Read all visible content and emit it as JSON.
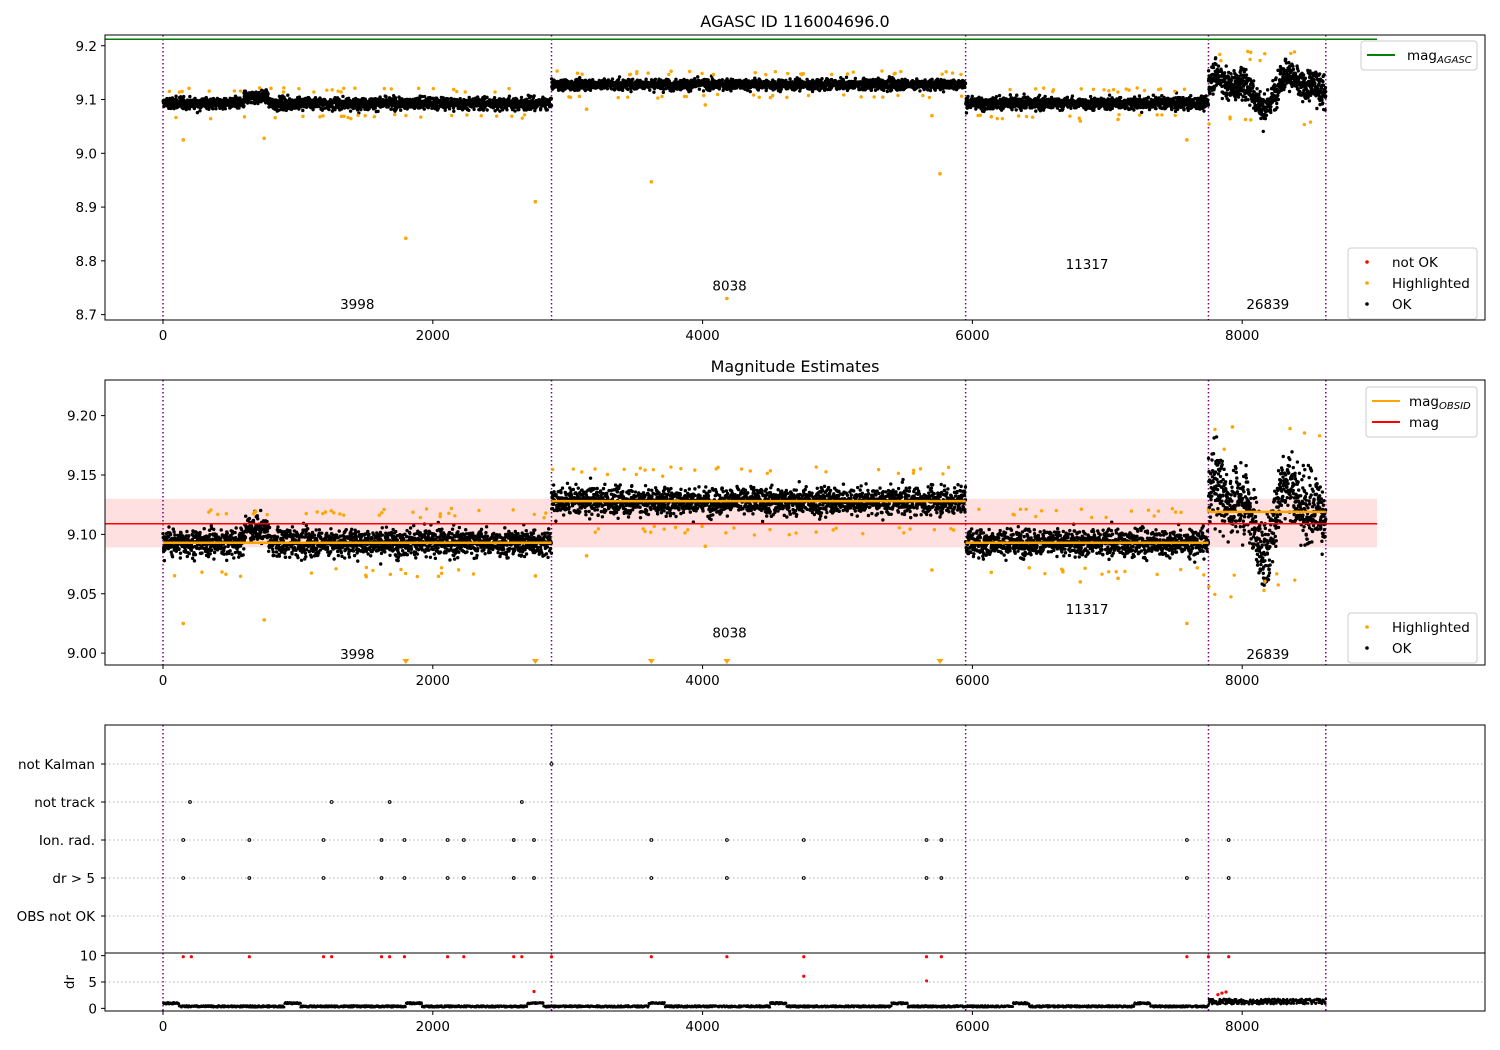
{
  "chart_data": [
    {
      "type": "scatter",
      "title": "AGASC ID 116004696.0",
      "xlim": [
        -430,
        9800
      ],
      "ylim": [
        8.69,
        9.22
      ],
      "x_ticks": [
        0,
        2000,
        4000,
        6000,
        8000
      ],
      "y_ticks": [
        8.7,
        8.8,
        8.9,
        9.0,
        9.1,
        9.2
      ],
      "y_tick_labels": [
        "8.7",
        "8.8",
        "8.9",
        "9.0",
        "9.1",
        "9.2"
      ],
      "obs_boundaries": [
        0,
        2880,
        5950,
        7750,
        8620
      ],
      "obs_labels": [
        {
          "text": "3998",
          "x": 1440,
          "y": 8.71
        },
        {
          "text": "8038",
          "x": 4200,
          "y": 8.745
        },
        {
          "text": "11317",
          "x": 6850,
          "y": 8.785
        },
        {
          "text": "26839",
          "x": 8190,
          "y": 8.71
        }
      ],
      "segments": [
        {
          "x0": 0,
          "x1": 2880,
          "level": 9.093,
          "noise": 0.008
        },
        {
          "x0": 2880,
          "x1": 5950,
          "level": 9.128,
          "noise": 0.007
        },
        {
          "x0": 5950,
          "x1": 7750,
          "level": 9.093,
          "noise": 0.008
        },
        {
          "x0": 7750,
          "x1": 8620,
          "level": 9.12,
          "noise": 0.02
        }
      ],
      "series": [
        {
          "name": "mag_AGASC",
          "type": "line",
          "color": "#008000",
          "y": 9.212,
          "x": [
            -430,
            9000
          ]
        }
      ],
      "highlighted_outliers": [
        {
          "x": 150,
          "y": 9.025
        },
        {
          "x": 750,
          "y": 9.028
        },
        {
          "x": 1800,
          "y": 8.842
        },
        {
          "x": 2760,
          "y": 8.91
        },
        {
          "x": 3620,
          "y": 8.947
        },
        {
          "x": 4180,
          "y": 8.73
        },
        {
          "x": 5760,
          "y": 8.962
        },
        {
          "x": 7590,
          "y": 9.025
        },
        {
          "x": 5700,
          "y": 9.07
        },
        {
          "x": 4020,
          "y": 9.09
        },
        {
          "x": 3140,
          "y": 9.082
        },
        {
          "x": 6140,
          "y": 9.068
        },
        {
          "x": 6800,
          "y": 9.06
        },
        {
          "x": 7080,
          "y": 9.063
        }
      ],
      "legend": {
        "placement": "top-right",
        "entries": [
          {
            "label": "mag",
            "sub": "AGASC",
            "color": "#008000"
          }
        ]
      },
      "legend2": {
        "placement": "lower-right",
        "entries": [
          {
            "label": "not OK",
            "color": "#ff0000"
          },
          {
            "label": "Highlighted",
            "color": "#ffa500"
          },
          {
            "label": "OK",
            "color": "#000000"
          }
        ]
      }
    },
    {
      "type": "scatter",
      "title": "Magnitude Estimates",
      "xlim": [
        -430,
        9800
      ],
      "ylim": [
        8.99,
        9.23
      ],
      "x_ticks": [
        0,
        2000,
        4000,
        6000,
        8000
      ],
      "y_ticks": [
        9.0,
        9.05,
        9.1,
        9.15,
        9.2
      ],
      "y_tick_labels": [
        "9.00",
        "9.05",
        "9.10",
        "9.15",
        "9.20"
      ],
      "obs_boundaries": [
        0,
        2880,
        5950,
        7750,
        8620
      ],
      "obs_labels": [
        {
          "text": "3998",
          "x": 1440,
          "y": 8.995
        },
        {
          "text": "8038",
          "x": 4200,
          "y": 9.013
        },
        {
          "text": "11317",
          "x": 6850,
          "y": 9.033
        },
        {
          "text": "26839",
          "x": 8190,
          "y": 8.995
        }
      ],
      "mag": {
        "value": 9.109,
        "band": [
          9.089,
          9.13
        ],
        "color": "#ff0000",
        "x": [
          -430,
          9000
        ]
      },
      "mag_obsid": [
        {
          "x0": 0,
          "x1": 2880,
          "value": 9.093
        },
        {
          "x0": 2880,
          "x1": 5950,
          "value": 9.128
        },
        {
          "x0": 5950,
          "x1": 7750,
          "value": 9.093
        },
        {
          "x0": 7750,
          "x1": 8620,
          "value": 9.119
        }
      ],
      "clipped_markers_x": [
        1800,
        2760,
        3620,
        4180,
        5760
      ],
      "legend": {
        "placement": "top-right",
        "entries": [
          {
            "label": "mag",
            "sub": "OBSID",
            "color": "#ffa500"
          },
          {
            "label": "mag",
            "color": "#ff0000"
          }
        ]
      },
      "legend2": {
        "placement": "lower-right",
        "entries": [
          {
            "label": "Highlighted",
            "color": "#ffa500"
          },
          {
            "label": "OK",
            "color": "#000000"
          }
        ]
      }
    },
    {
      "type": "scatter",
      "xlim": [
        -430,
        9800
      ],
      "flag_rows": [
        "not Kalman",
        "not track",
        "Ion. rad.",
        "dr > 5",
        "OBS not OK"
      ],
      "flag_points": {
        "not Kalman": [
          2880
        ],
        "not track": [
          200,
          1250,
          1680,
          2660
        ],
        "Ion. rad.": [
          150,
          640,
          1190,
          1620,
          1790,
          2110,
          2230,
          2600,
          2750,
          3620,
          4180,
          4750,
          5660,
          5770,
          7590,
          7900
        ],
        "dr > 5": [
          150,
          640,
          1190,
          1620,
          1790,
          2110,
          2230,
          2600,
          2750,
          3620,
          4180,
          4750,
          5660,
          5770,
          7590,
          7900
        ],
        "OBS not OK": []
      },
      "dr_panel": {
        "ylabel": "dr",
        "y_ticks": [
          0,
          5,
          10
        ],
        "ylim": [
          -0.5,
          10.5
        ],
        "red_points": [
          {
            "x": 150,
            "y": 9.8
          },
          {
            "x": 210,
            "y": 9.8
          },
          {
            "x": 640,
            "y": 9.8
          },
          {
            "x": 1190,
            "y": 9.8
          },
          {
            "x": 1250,
            "y": 9.8
          },
          {
            "x": 1620,
            "y": 9.8
          },
          {
            "x": 1680,
            "y": 9.8
          },
          {
            "x": 1790,
            "y": 9.8
          },
          {
            "x": 2110,
            "y": 9.8
          },
          {
            "x": 2230,
            "y": 9.8
          },
          {
            "x": 2600,
            "y": 9.8
          },
          {
            "x": 2660,
            "y": 9.8
          },
          {
            "x": 2750,
            "y": 3.2
          },
          {
            "x": 2880,
            "y": 9.8
          },
          {
            "x": 3620,
            "y": 9.8
          },
          {
            "x": 4180,
            "y": 9.8
          },
          {
            "x": 4750,
            "y": 9.8
          },
          {
            "x": 4750,
            "y": 6.1
          },
          {
            "x": 5660,
            "y": 9.8
          },
          {
            "x": 5660,
            "y": 5.2
          },
          {
            "x": 5770,
            "y": 9.8
          },
          {
            "x": 7590,
            "y": 9.8
          },
          {
            "x": 7750,
            "y": 9.8
          },
          {
            "x": 7900,
            "y": 9.8
          },
          {
            "x": 7820,
            "y": 2.6
          },
          {
            "x": 7850,
            "y": 2.9
          },
          {
            "x": 7880,
            "y": 3.1
          }
        ]
      }
    }
  ]
}
